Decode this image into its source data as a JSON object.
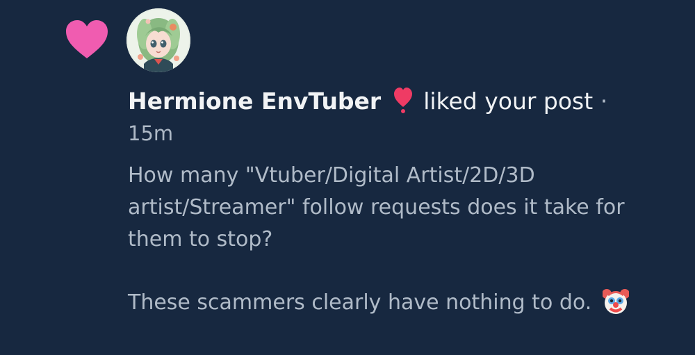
{
  "notification": {
    "icon": "heart-icon",
    "accent_color": "#f05cb0",
    "avatar": "avatar",
    "author": "Hermione EnvTuber",
    "reaction_icon": "heart-exclamation-icon",
    "action": "liked your post",
    "separator": "·",
    "time": "15m",
    "post_text_line1": "How many \"Vtuber/Digital Artist/2D/3D artist/Streamer\" follow requests does it take for them to stop?",
    "post_text_line2": "These scammers clearly have nothing to do.",
    "post_text_emoji": "clown-face-icon"
  }
}
